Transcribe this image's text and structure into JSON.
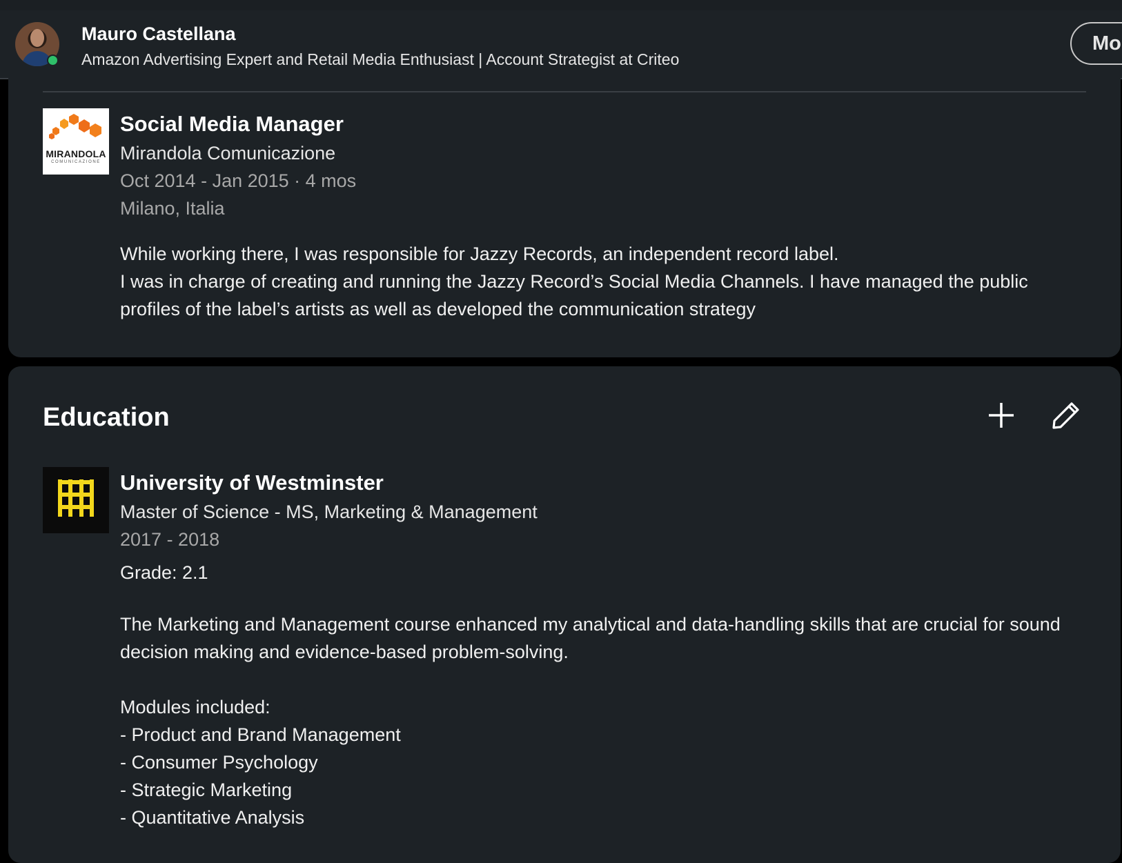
{
  "profile_bar": {
    "name": "Mauro Castellana",
    "headline": "Amazon Advertising Expert and Retail Media Enthusiast | Account Strategist at Criteo",
    "more_label": "More",
    "presence_color": "#2fc06a"
  },
  "experience_entry": {
    "title": "Social Media Manager",
    "company": "Mirandola Comunicazione",
    "dates": "Oct 2014 - Jan 2015 · 4 mos",
    "location": "Milano, Italia",
    "description_line1": "While working there, I was responsible for Jazzy Records, an independent record label.",
    "description_line2": "I was in charge of creating and running the Jazzy Record’s Social Media Channels. I have managed the public profiles of the label’s artists as well as developed the communication strategy",
    "logo": {
      "word": "MIRANDOLA",
      "sub": "COMUNICAZIONE",
      "accent_color": "#f07a1a"
    }
  },
  "education": {
    "section_title": "Education",
    "add_icon": "plus-icon",
    "edit_icon": "pencil-icon",
    "entry": {
      "school": "University of Westminster",
      "degree": "Master of Science - MS, Marketing & Management",
      "dates": "2017 - 2018",
      "grade": "Grade: 2.1",
      "description": "The Marketing and Management course enhanced my analytical and data-handling skills that are crucial for sound decision making and evidence-based problem-solving.",
      "modules_heading": "Modules included:",
      "modules": [
        "- Product and Brand Management",
        "- Consumer Psychology",
        "- Strategic Marketing",
        "- Quantitative Analysis"
      ],
      "logo_color": "#f3d71b"
    }
  }
}
